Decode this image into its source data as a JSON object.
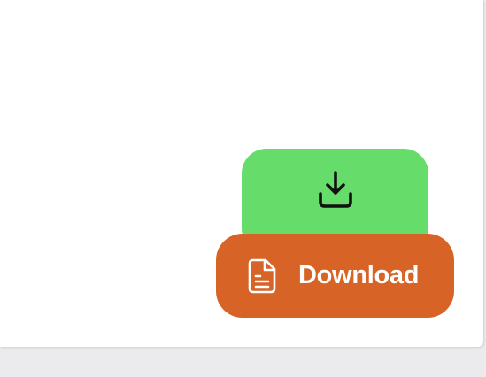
{
  "actions": {
    "primary_download": {
      "icon": "download-tray-icon",
      "color": "#66dd6b"
    },
    "secondary_download": {
      "label": "Download",
      "icon": "document-icon",
      "color": "#d76327",
      "text_color": "#ffffff"
    }
  },
  "page": {
    "background": "#ebebed",
    "card_background": "#ffffff"
  }
}
